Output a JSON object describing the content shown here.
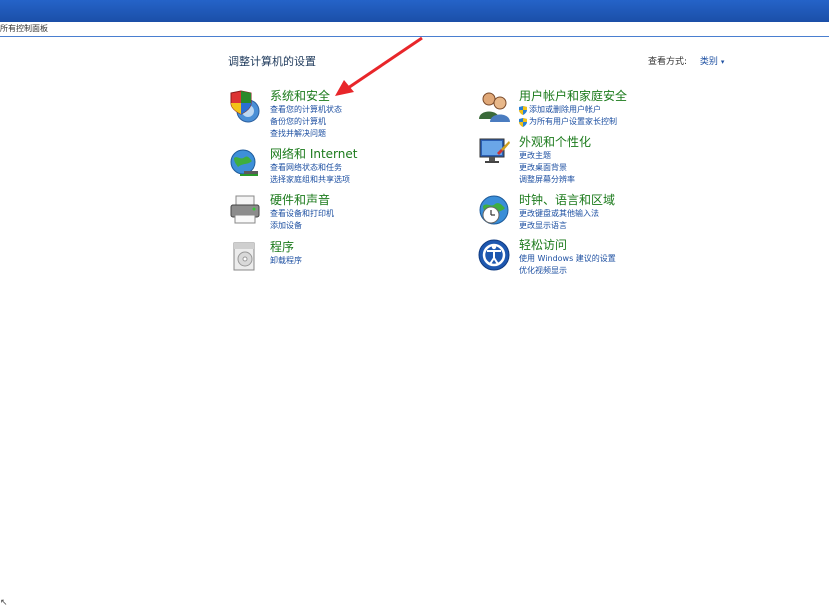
{
  "window": {
    "address_text": "所有控制面板"
  },
  "header": {
    "page_title": "调整计算机的设置",
    "view_by_label": "查看方式:",
    "view_by_value": "类别"
  },
  "categories": [
    {
      "title": "系统和安全",
      "icon": "system-security-icon",
      "links": [
        "查看您的计算机状态",
        "备份您的计算机",
        "查找并解决问题"
      ]
    },
    {
      "title": "网络和 Internet",
      "icon": "network-internet-icon",
      "links": [
        "查看网络状态和任务",
        "选择家庭组和共享选项"
      ]
    },
    {
      "title": "硬件和声音",
      "icon": "hardware-sound-icon",
      "links": [
        "查看设备和打印机",
        "添加设备"
      ]
    },
    {
      "title": "程序",
      "icon": "programs-icon",
      "links": [
        "卸载程序"
      ]
    },
    {
      "title": "用户帐户和家庭安全",
      "icon": "user-accounts-icon",
      "links": [
        "添加或删除用户帐户",
        "为所有用户设置家长控制"
      ]
    },
    {
      "title": "外观和个性化",
      "icon": "appearance-icon",
      "links": [
        "更改主题",
        "更改桌面背景",
        "调整屏幕分辨率"
      ]
    },
    {
      "title": "时钟、语言和区域",
      "icon": "clock-language-icon",
      "links": [
        "更改键盘或其他输入法",
        "更改显示语言"
      ]
    },
    {
      "title": "轻松访问",
      "icon": "ease-of-access-icon",
      "links": [
        "使用 Windows 建议的设置",
        "优化视频显示"
      ]
    }
  ],
  "colors": {
    "category_title": "#1b7a1b",
    "link": "#1e50a2",
    "annotation_arrow": "#e8262a"
  }
}
